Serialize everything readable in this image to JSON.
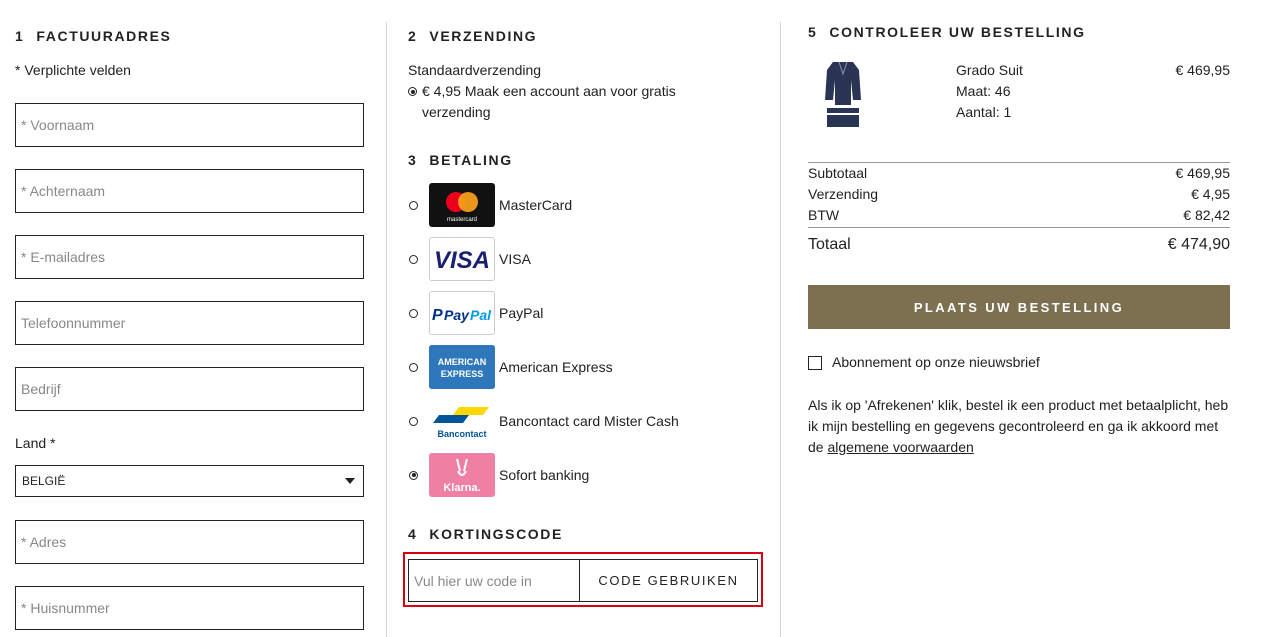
{
  "billing": {
    "number": "1",
    "title": "FACTUURADRES",
    "required_note": "* Verplichte velden",
    "fields": {
      "firstname": "* Voornaam",
      "lastname": "* Achternaam",
      "email": "* E-mailadres",
      "phone": "Telefoonnummer",
      "company": "Bedrijf",
      "address": "* Adres",
      "housenumber": "* Huisnummer"
    },
    "country_label": "Land *",
    "country_value": "BELGIË"
  },
  "shipping": {
    "number": "2",
    "title": "VERZENDING",
    "method": "Standaardverzending",
    "option_text": "€ 4,95 Maak een account aan voor gratis verzending"
  },
  "payment": {
    "number": "3",
    "title": "BETALING",
    "methods": [
      {
        "label": "MasterCard",
        "selected": false
      },
      {
        "label": "VISA",
        "selected": false
      },
      {
        "label": "PayPal",
        "selected": false
      },
      {
        "label": "American Express",
        "selected": false
      },
      {
        "label": "Bancontact card Mister Cash",
        "selected": false
      },
      {
        "label": "Sofort banking",
        "selected": true
      }
    ],
    "logo_text": {
      "mastercard": "mastercard",
      "visa": "VISA",
      "paypal_pay": "Pay",
      "paypal_pal": "Pal",
      "amex_1": "AMERICAN",
      "amex_2": "EXPRESS",
      "bancontact": "Bancontact",
      "klarna": "Klarna."
    }
  },
  "coupon": {
    "number": "4",
    "title": "KORTINGSCODE",
    "placeholder": "Vul hier uw code in",
    "button": "CODE GEBRUIKEN"
  },
  "review": {
    "number": "5",
    "title": "CONTROLEER UW BESTELLING",
    "product": {
      "name": "Grado Suit",
      "size": "Maat: 46",
      "qty": "Aantal: 1",
      "price": "€ 469,95"
    },
    "subtotal_label": "Subtotaal",
    "subtotal": "€ 469,95",
    "shipping_label": "Verzending",
    "shipping": "€ 4,95",
    "vat_label": "BTW",
    "vat": "€ 82,42",
    "total_label": "Totaal",
    "total": "€ 474,90",
    "place_order": "PLAATS UW BESTELLING",
    "newsletter": "Abonnement op onze nieuwsbrief",
    "terms_text": "Als ik op 'Afrekenen' klik, bestel ik een product met betaalplicht, heb ik mijn bestelling en gegevens gecontroleerd en ga ik akkoord met de",
    "terms_link": "algemene voorwaarden"
  },
  "colors": {
    "accent": "#7c7051",
    "highlight": "#d9000f",
    "mastercard_red": "#eb001b",
    "mastercard_orange": "#f79e1b",
    "visa_blue": "#1a1f71",
    "paypal_blue": "#003087",
    "amex_blue": "#2e77bb",
    "klarna_pink": "#ffb3c7"
  }
}
